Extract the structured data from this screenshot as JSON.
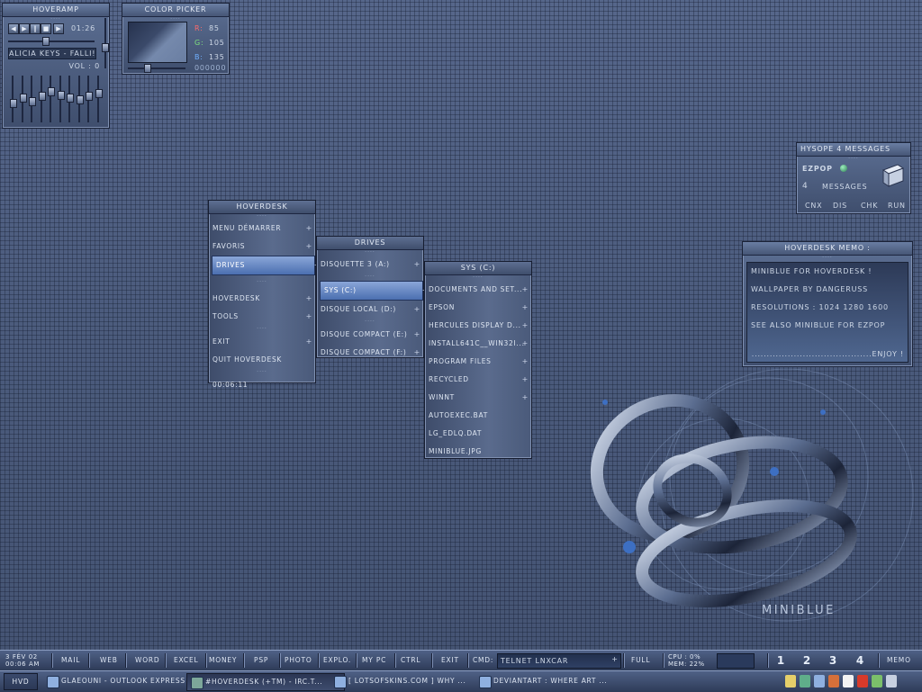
{
  "hoveramp": {
    "title": "HOVERAMP",
    "time": "01:26",
    "track": "ALICIA KEYS - FALLI!",
    "volume": "VOL : 0",
    "buttons": [
      "◀",
      "▶",
      "‖",
      "■",
      "▶"
    ],
    "eq_levels": [
      0.4,
      0.55,
      0.45,
      0.6,
      0.7,
      0.62,
      0.55,
      0.5,
      0.58,
      0.65
    ]
  },
  "color_picker": {
    "title": "COLOR PICKER",
    "r_label": "R:",
    "r": "85",
    "g_label": "G:",
    "g": "105",
    "b_label": "B:",
    "b": "135",
    "hex": "000000",
    "swatch": "#556987"
  },
  "hysope": {
    "title": "HYSOPE  4  MESSAGES",
    "app": "EZPOP",
    "count": "4",
    "messages_label": "MESSAGES",
    "buttons": [
      "CNX",
      "DIS",
      "CHK",
      "RUN"
    ]
  },
  "memo": {
    "title": "HOVERDESK MEMO :",
    "lines": [
      "MINIBLUE FOR HOVERDESK !",
      "WALLPAPER BY DANGERUSS",
      "RESOLUTIONS : 1024 1280 1600",
      "SEE ALSO MINIBLUE FOR EZPOP"
    ],
    "footer": "........................................ENJOY !"
  },
  "menu_main": {
    "title": "HOVERDESK",
    "items": [
      {
        "label": "MENU DÉMARRER",
        "arrow": "+"
      },
      {
        "label": "FAVORIS",
        "arrow": "+"
      },
      {
        "label": "DRIVES",
        "arrow": "+"
      },
      {
        "label": "HOVERDESK",
        "arrow": "+"
      },
      {
        "label": "TOOLS",
        "arrow": "+"
      },
      {
        "label": "EXIT",
        "arrow": "+"
      },
      {
        "label": "QUIT HOVERDESK",
        "arrow": ""
      },
      {
        "label": "00:06:11",
        "arrow": ""
      }
    ]
  },
  "menu_drives": {
    "title": "DRIVES",
    "items": [
      {
        "label": "DISQUETTE 3 (A:)",
        "arrow": "+"
      },
      {
        "label": "SYS (C:)",
        "arrow": "+"
      },
      {
        "label": "DISQUE LOCAL (D:)",
        "arrow": "+"
      },
      {
        "label": "DISQUE COMPACT (E:)",
        "arrow": "+"
      },
      {
        "label": "DISQUE COMPACT (F:)",
        "arrow": "+"
      }
    ]
  },
  "menu_sys": {
    "title": "SYS (C:)",
    "items": [
      {
        "label": "DOCUMENTS AND SET...",
        "arrow": "+"
      },
      {
        "label": "EPSON",
        "arrow": "+"
      },
      {
        "label": "HERCULES DISPLAY D...",
        "arrow": "+"
      },
      {
        "label": "INSTALL641C__WIN32I...",
        "arrow": "+"
      },
      {
        "label": "PROGRAM FILES",
        "arrow": "+"
      },
      {
        "label": "RECYCLED",
        "arrow": "+"
      },
      {
        "label": "WINNT",
        "arrow": "+"
      },
      {
        "label": "AUTOEXEC.BAT",
        "arrow": ""
      },
      {
        "label": "LG_EDLQ.DAT",
        "arrow": ""
      },
      {
        "label": "MINIBLUE.JPG",
        "arrow": ""
      }
    ]
  },
  "logo": {
    "text": "MINIBLUE"
  },
  "taskbar_top": {
    "date": "3 FÉV 02",
    "time": "00:06 AM",
    "launchers": [
      "MAIL",
      "WEB",
      "WORD",
      "EXCEL",
      "MONEY",
      "PSP",
      "PHOTO",
      "EXPLO.",
      "MY PC",
      "CTRL",
      "EXIT"
    ],
    "cmd_label": "CMD:",
    "cmd_value": "TELNET LNXCAR",
    "full": "FULL",
    "cpu": "CPU : 0%",
    "mem": "MEM: 22%",
    "workspaces": [
      "1",
      "2",
      "3",
      "4"
    ],
    "memo": "MEMO"
  },
  "taskbar_bottom": {
    "hvd": "HVD",
    "tasks": [
      "GLAEOUNI - OUTLOOK EXPRESS",
      "#HOVERDESK (+TM) - IRC.T...",
      "[ LOTSOFSKINS.COM ] WHY ...",
      "DEVIANTART : WHERE ART ..."
    ],
    "tray": [
      "speaker-icon",
      "network-icon",
      "paint-icon",
      "pen-icon",
      "mail-icon",
      "za-icon",
      "monitor-icon",
      "globe-icon"
    ]
  },
  "colors": {
    "accent": "#4b6fb0",
    "desktop": "#4b5b7c"
  }
}
